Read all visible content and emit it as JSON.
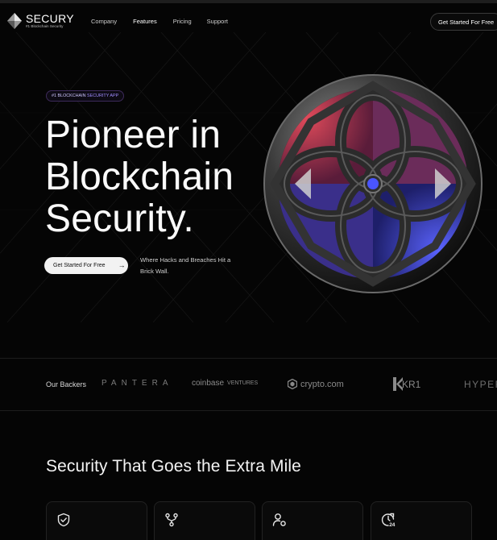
{
  "brand": {
    "name": "SECURY",
    "tagline": "#1 Blockchain Security"
  },
  "nav": {
    "items": [
      "Company",
      "Features",
      "Pricing",
      "Support"
    ],
    "cta": "Get Started For Free"
  },
  "hero": {
    "badge": {
      "prefix": "#1 BLOCKCHAIN",
      "highlight": "SECURITY APP"
    },
    "headline": [
      "Pioneer in",
      "Blockchain",
      "Security."
    ],
    "cta": "Get Started For Free",
    "cta_icon": "arrow-right-icon",
    "subtext": "Where Hacks and Breaches Hit a Brick Wall."
  },
  "backers": {
    "label": "Our Backers",
    "logos": [
      "PANTERA",
      "coinbase",
      "VENTURES",
      "crypto.com",
      "KR1",
      "HYPERS"
    ]
  },
  "features": {
    "title": "Security That Goes the Extra Mile",
    "card_icons": [
      "shield-check-icon",
      "git-branch-icon",
      "user-settings-icon",
      "clock-24-icon"
    ]
  },
  "colors": {
    "background": "#050505",
    "accent_purple": "#6b4bd8",
    "sphere_red": "#c43a4a",
    "sphere_blue": "#3b4bd6"
  }
}
